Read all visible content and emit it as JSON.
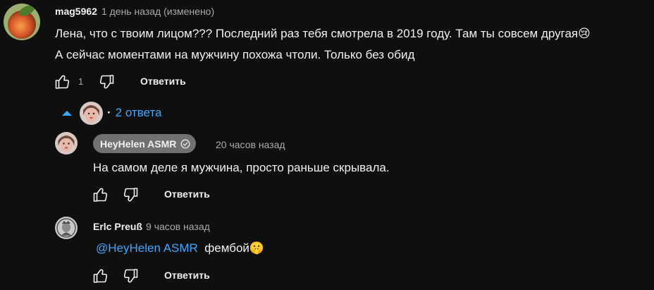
{
  "comment": {
    "author": "mag5962",
    "time": "1 день назад (изменено)",
    "line1": "Лена, что с твоим лицом??? Последний раз тебя смотрела в 2019 году. Там ты совсем другая",
    "line1_emoji": "😢",
    "line2": "А сейчас моментами на мужчину похожа чтоли. Только без обид",
    "like_count": "1",
    "reply_label": "Ответить"
  },
  "replies_toggle": {
    "label": "2 ответа",
    "separator": "·"
  },
  "replies": [
    {
      "author": "HeyHelen ASMR",
      "verified_icon": "check-circle-icon",
      "time": "20 часов назад",
      "text": "На самом деле я мужчина, просто раньше скрывала.",
      "reply_label": "Ответить"
    },
    {
      "author": "Erlc Preuß",
      "time": "9 часов назад",
      "mention": "@HeyHelen ASMR",
      "text": "фембой",
      "text_emoji": "🤫",
      "reply_label": "Ответить"
    }
  ],
  "colors": {
    "background": "#0f0f0f",
    "text": "#f1f1f1",
    "secondary": "#aaaaaa",
    "link": "#3ea6ff",
    "chip": "#717171"
  }
}
